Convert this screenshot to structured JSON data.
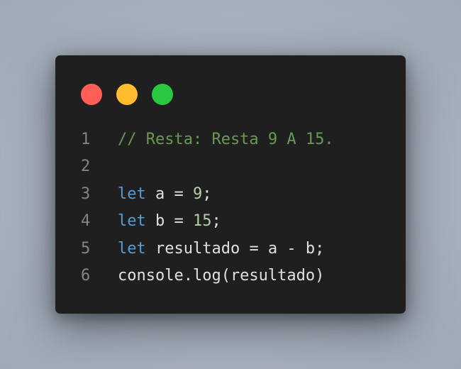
{
  "window": {
    "dots": [
      "close",
      "minimize",
      "maximize"
    ]
  },
  "code": {
    "lines": [
      {
        "number": "1",
        "comment": "// Resta: Resta 9 A 15."
      },
      {
        "number": "2"
      },
      {
        "number": "3",
        "kw": "let",
        "rest_a": " a = ",
        "num": "9",
        "tail": ";"
      },
      {
        "number": "4",
        "kw": "let",
        "rest_a": " b = ",
        "num": "15",
        "tail": ";"
      },
      {
        "number": "5",
        "kw": "let",
        "rest_a": " resultado = a - b;"
      },
      {
        "number": "6",
        "plain": "console.log(resultado)"
      }
    ]
  },
  "colors": {
    "background": "#a9b3be",
    "window": "#1f1f1f",
    "close": "#ff5f57",
    "minimize": "#ffbd2e",
    "maximize": "#28c840",
    "comment": "#6a9955",
    "keyword": "#569cd6",
    "number": "#b5cea8",
    "text": "#e0e0e0",
    "line_number": "#858585"
  }
}
